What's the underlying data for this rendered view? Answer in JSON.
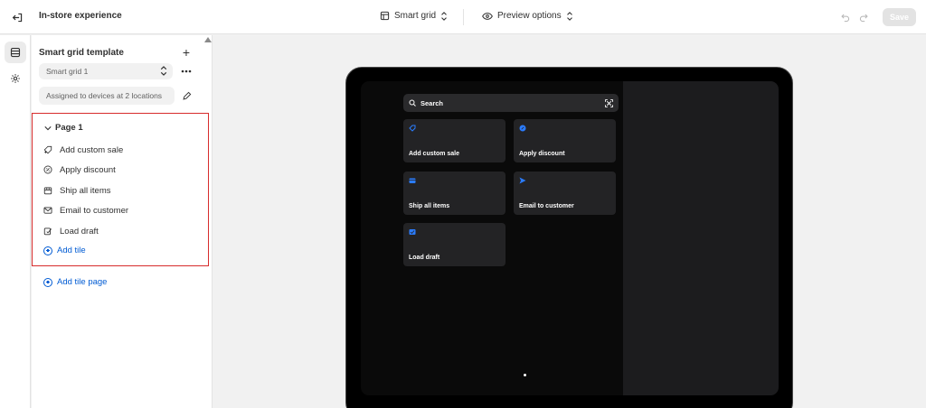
{
  "topbar": {
    "title": "In-store experience",
    "grid_select": "Smart grid",
    "preview_select": "Preview options",
    "save_label": "Save"
  },
  "panel": {
    "section_title": "Smart grid template",
    "template_value": "Smart grid 1",
    "assigned_text": "Assigned to devices at 2 locations",
    "page_label": "Page 1",
    "items": [
      {
        "label": "Add custom sale",
        "icon": "tag-plus-icon"
      },
      {
        "label": "Apply discount",
        "icon": "discount-icon"
      },
      {
        "label": "Ship all items",
        "icon": "package-icon"
      },
      {
        "label": "Email to customer",
        "icon": "email-icon"
      },
      {
        "label": "Load draft",
        "icon": "draft-icon"
      }
    ],
    "add_tile": "Add tile",
    "add_tile_page": "Add tile page"
  },
  "preview": {
    "search_label": "Search",
    "tiles": [
      {
        "label": "Add custom sale",
        "icon": "tag-icon"
      },
      {
        "label": "Apply discount",
        "icon": "discount-icon"
      },
      {
        "label": "Ship all items",
        "icon": "package-icon"
      },
      {
        "label": "Email to customer",
        "icon": "send-icon"
      },
      {
        "label": "Load draft",
        "icon": "draft-icon"
      }
    ]
  },
  "colors": {
    "accent": "#005bd3",
    "highlight_border": "#d72c2c",
    "tile_icon": "#2b7cff"
  }
}
